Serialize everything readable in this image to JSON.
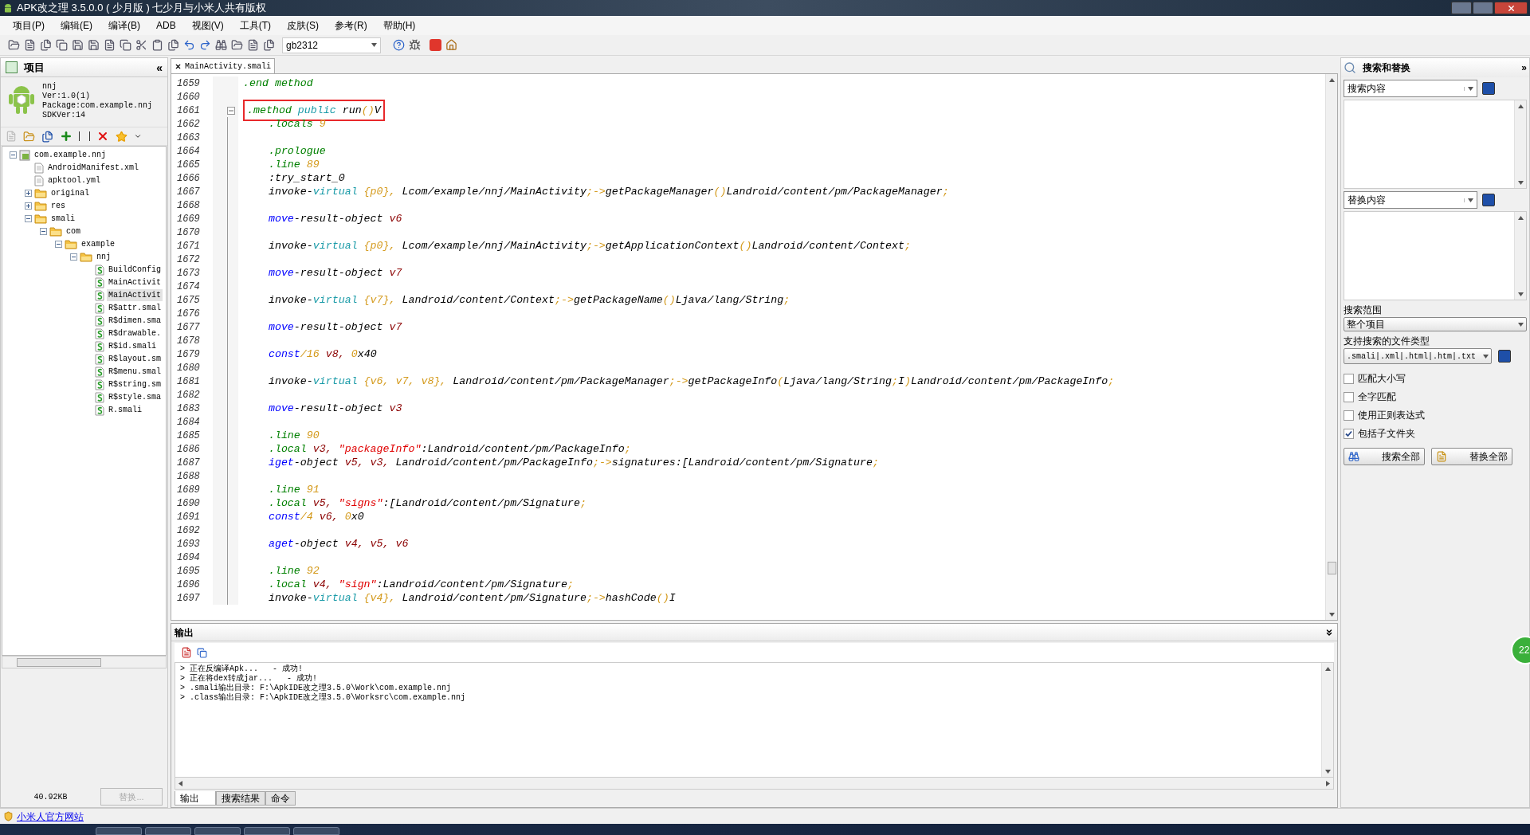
{
  "window": {
    "title": "APK改之理 3.5.0.0 ( 少月版 ) 七少月与小米人共有版权"
  },
  "menu": [
    "项目(P)",
    "编辑(E)",
    "编译(B)",
    "ADB",
    "视图(V)",
    "工具(T)",
    "皮肤(S)",
    "参考(R)",
    "帮助(H)"
  ],
  "toolbar": {
    "encoding": "gb2312"
  },
  "project_panel": {
    "title": "项目",
    "collapse": "«",
    "app": {
      "name": "nnj",
      "version": "Ver:1.0(1)",
      "package": "Package:com.example.nnj",
      "sdk": "SDKVer:14"
    },
    "tree": [
      {
        "label": "com.example.nnj",
        "kind": "project",
        "expanded": true,
        "selected": false,
        "children": [
          {
            "label": "AndroidManifest.xml",
            "kind": "file",
            "selected": false
          },
          {
            "label": "apktool.yml",
            "kind": "file",
            "selected": false
          },
          {
            "label": "original",
            "kind": "folder",
            "expanded": false,
            "selected": false
          },
          {
            "label": "res",
            "kind": "folder",
            "expanded": false,
            "selected": false
          },
          {
            "label": "smali",
            "kind": "folder",
            "expanded": true,
            "selected": false,
            "children": [
              {
                "label": "com",
                "kind": "folder",
                "expanded": true,
                "selected": false,
                "children": [
                  {
                    "label": "example",
                    "kind": "folder",
                    "expanded": true,
                    "selected": false,
                    "children": [
                      {
                        "label": "nnj",
                        "kind": "folder",
                        "expanded": true,
                        "selected": false,
                        "children": [
                          {
                            "label": "BuildConfig",
                            "kind": "smali",
                            "selected": false
                          },
                          {
                            "label": "MainActivit",
                            "kind": "smali",
                            "selected": false
                          },
                          {
                            "label": "MainActivit",
                            "kind": "smali",
                            "selected": true
                          },
                          {
                            "label": "R$attr.smal",
                            "kind": "smali",
                            "selected": false
                          },
                          {
                            "label": "R$dimen.sma",
                            "kind": "smali",
                            "selected": false
                          },
                          {
                            "label": "R$drawable.",
                            "kind": "smali",
                            "selected": false
                          },
                          {
                            "label": "R$id.smali",
                            "kind": "smali",
                            "selected": false
                          },
                          {
                            "label": "R$layout.sm",
                            "kind": "smali",
                            "selected": false
                          },
                          {
                            "label": "R$menu.smal",
                            "kind": "smali",
                            "selected": false
                          },
                          {
                            "label": "R$string.sm",
                            "kind": "smali",
                            "selected": false
                          },
                          {
                            "label": "R$style.sma",
                            "kind": "smali",
                            "selected": false
                          },
                          {
                            "label": "R.smali",
                            "kind": "smali",
                            "selected": false
                          }
                        ]
                      }
                    ]
                  }
                ]
              }
            ]
          }
        ]
      }
    ],
    "size": "40.92KB",
    "replace_button": {
      "label": "替换...",
      "disabled": true
    }
  },
  "editor": {
    "tabs": [
      {
        "label": "MainActivity.smali",
        "selected": true
      }
    ],
    "lines": [
      {
        "number": "1659",
        "fold": false,
        "boxed": false,
        "tokens": [
          {
            "kind": "directive",
            "text": ".end method"
          }
        ]
      },
      {
        "number": "1660",
        "fold": false
      },
      {
        "number": "1661",
        "fold": true,
        "boxed": true,
        "tokens": [
          {
            "kind": "directive",
            "text": ".method "
          },
          {
            "kind": "keyword",
            "text": "public"
          },
          {
            "kind": "plain",
            "text": " run"
          },
          {
            "kind": "punct",
            "text": "()"
          },
          {
            "kind": "plain",
            "text": "V"
          }
        ]
      },
      {
        "number": "1662",
        "fold": false,
        "boxed": false,
        "tokens": [
          {
            "kind": "directive",
            "text": "    .locals "
          },
          {
            "kind": "punct",
            "text": "9"
          }
        ]
      },
      {
        "number": "1663",
        "fold": false
      },
      {
        "number": "1664",
        "fold": false,
        "boxed": false,
        "tokens": [
          {
            "kind": "directive",
            "text": "    .prologue"
          }
        ]
      },
      {
        "number": "1665",
        "fold": false,
        "boxed": false,
        "tokens": [
          {
            "kind": "directive",
            "text": "    .line "
          },
          {
            "kind": "punct",
            "text": "89"
          }
        ]
      },
      {
        "number": "1666",
        "fold": false,
        "boxed": false,
        "tokens": [
          {
            "kind": "plain",
            "text": "    :try_start_0"
          }
        ]
      },
      {
        "number": "1667",
        "fold": false,
        "boxed": false,
        "tokens": [
          {
            "kind": "plain",
            "text": "    invoke-"
          },
          {
            "kind": "keyword",
            "text": "virtual"
          },
          {
            "kind": "punct",
            "text": " {p0}, "
          },
          {
            "kind": "plain",
            "text": "Lcom/example/nnj/MainActivity"
          },
          {
            "kind": "punct",
            "text": ";->"
          },
          {
            "kind": "plain",
            "text": "getPackageManager"
          },
          {
            "kind": "punct",
            "text": "()"
          },
          {
            "kind": "plain",
            "text": "Landroid/content/pm/PackageManager"
          },
          {
            "kind": "punct",
            "text": ";"
          }
        ]
      },
      {
        "number": "1668",
        "fold": false
      },
      {
        "number": "1669",
        "fold": false,
        "boxed": false,
        "tokens": [
          {
            "kind": "op",
            "text": "    move"
          },
          {
            "kind": "plain",
            "text": "-result-object "
          },
          {
            "kind": "register",
            "text": "v6"
          }
        ]
      },
      {
        "number": "1670",
        "fold": false
      },
      {
        "number": "1671",
        "fold": false,
        "boxed": false,
        "tokens": [
          {
            "kind": "plain",
            "text": "    invoke-"
          },
          {
            "kind": "keyword",
            "text": "virtual"
          },
          {
            "kind": "punct",
            "text": " {p0}, "
          },
          {
            "kind": "plain",
            "text": "Lcom/example/nnj/MainActivity"
          },
          {
            "kind": "punct",
            "text": ";->"
          },
          {
            "kind": "plain",
            "text": "getApplicationContext"
          },
          {
            "kind": "punct",
            "text": "()"
          },
          {
            "kind": "plain",
            "text": "Landroid/content/Context"
          },
          {
            "kind": "punct",
            "text": ";"
          }
        ]
      },
      {
        "number": "1672",
        "fold": false
      },
      {
        "number": "1673",
        "fold": false,
        "boxed": false,
        "tokens": [
          {
            "kind": "op",
            "text": "    move"
          },
          {
            "kind": "plain",
            "text": "-result-object "
          },
          {
            "kind": "register",
            "text": "v7"
          }
        ]
      },
      {
        "number": "1674",
        "fold": false
      },
      {
        "number": "1675",
        "fold": false,
        "boxed": false,
        "tokens": [
          {
            "kind": "plain",
            "text": "    invoke-"
          },
          {
            "kind": "keyword",
            "text": "virtual"
          },
          {
            "kind": "punct",
            "text": " {v7}, "
          },
          {
            "kind": "plain",
            "text": "Landroid/content/Context"
          },
          {
            "kind": "punct",
            "text": ";->"
          },
          {
            "kind": "plain",
            "text": "getPackageName"
          },
          {
            "kind": "punct",
            "text": "()"
          },
          {
            "kind": "plain",
            "text": "Ljava/lang/String"
          },
          {
            "kind": "punct",
            "text": ";"
          }
        ]
      },
      {
        "number": "1676",
        "fold": false
      },
      {
        "number": "1677",
        "fold": false,
        "boxed": false,
        "tokens": [
          {
            "kind": "op",
            "text": "    move"
          },
          {
            "kind": "plain",
            "text": "-result-object "
          },
          {
            "kind": "register",
            "text": "v7"
          }
        ]
      },
      {
        "number": "1678",
        "fold": false
      },
      {
        "number": "1679",
        "fold": false,
        "boxed": false,
        "tokens": [
          {
            "kind": "op",
            "text": "    const"
          },
          {
            "kind": "punct",
            "text": "/16"
          },
          {
            "kind": "register",
            "text": " v8, "
          },
          {
            "kind": "punct",
            "text": "0"
          },
          {
            "kind": "plain",
            "text": "x40"
          }
        ]
      },
      {
        "number": "1680",
        "fold": false
      },
      {
        "number": "1681",
        "fold": false,
        "boxed": false,
        "tokens": [
          {
            "kind": "plain",
            "text": "    invoke-"
          },
          {
            "kind": "keyword",
            "text": "virtual"
          },
          {
            "kind": "punct",
            "text": " {v6, v7, v8}, "
          },
          {
            "kind": "plain",
            "text": "Landroid/content/pm/PackageManager"
          },
          {
            "kind": "punct",
            "text": ";->"
          },
          {
            "kind": "plain",
            "text": "getPackageInfo"
          },
          {
            "kind": "punct",
            "text": "("
          },
          {
            "kind": "plain",
            "text": "Ljava/lang/String"
          },
          {
            "kind": "punct",
            "text": ";"
          },
          {
            "kind": "plain",
            "text": "I"
          },
          {
            "kind": "punct",
            "text": ")"
          },
          {
            "kind": "plain",
            "text": "Landroid/content/pm/PackageInfo"
          },
          {
            "kind": "punct",
            "text": ";"
          }
        ]
      },
      {
        "number": "1682",
        "fold": false
      },
      {
        "number": "1683",
        "fold": false,
        "boxed": false,
        "tokens": [
          {
            "kind": "op",
            "text": "    move"
          },
          {
            "kind": "plain",
            "text": "-result-object "
          },
          {
            "kind": "register",
            "text": "v3"
          }
        ]
      },
      {
        "number": "1684",
        "fold": false
      },
      {
        "number": "1685",
        "fold": false,
        "boxed": false,
        "tokens": [
          {
            "kind": "directive",
            "text": "    .line "
          },
          {
            "kind": "punct",
            "text": "90"
          }
        ]
      },
      {
        "number": "1686",
        "fold": false,
        "boxed": false,
        "tokens": [
          {
            "kind": "directive",
            "text": "    .local "
          },
          {
            "kind": "register",
            "text": "v3, "
          },
          {
            "kind": "string",
            "text": "\"packageInfo\""
          },
          {
            "kind": "plain",
            "text": ":Landroid/content/pm/PackageInfo"
          },
          {
            "kind": "punct",
            "text": ";"
          }
        ]
      },
      {
        "number": "1687",
        "fold": false,
        "boxed": false,
        "tokens": [
          {
            "kind": "op",
            "text": "    iget"
          },
          {
            "kind": "plain",
            "text": "-object "
          },
          {
            "kind": "register",
            "text": "v5, v3, "
          },
          {
            "kind": "plain",
            "text": "Landroid/content/pm/PackageInfo"
          },
          {
            "kind": "punct",
            "text": ";->"
          },
          {
            "kind": "plain",
            "text": "signatures:[Landroid/content/pm/Signature"
          },
          {
            "kind": "punct",
            "text": ";"
          }
        ]
      },
      {
        "number": "1688",
        "fold": false
      },
      {
        "number": "1689",
        "fold": false,
        "boxed": false,
        "tokens": [
          {
            "kind": "directive",
            "text": "    .line "
          },
          {
            "kind": "punct",
            "text": "91"
          }
        ]
      },
      {
        "number": "1690",
        "fold": false,
        "boxed": false,
        "tokens": [
          {
            "kind": "directive",
            "text": "    .local "
          },
          {
            "kind": "register",
            "text": "v5, "
          },
          {
            "kind": "string",
            "text": "\"signs\""
          },
          {
            "kind": "plain",
            "text": ":[Landroid/content/pm/Signature"
          },
          {
            "kind": "punct",
            "text": ";"
          }
        ]
      },
      {
        "number": "1691",
        "fold": false,
        "boxed": false,
        "tokens": [
          {
            "kind": "op",
            "text": "    const"
          },
          {
            "kind": "punct",
            "text": "/4"
          },
          {
            "kind": "register",
            "text": " v6, "
          },
          {
            "kind": "punct",
            "text": "0"
          },
          {
            "kind": "plain",
            "text": "x0"
          }
        ]
      },
      {
        "number": "1692",
        "fold": false
      },
      {
        "number": "1693",
        "fold": false,
        "boxed": false,
        "tokens": [
          {
            "kind": "op",
            "text": "    aget"
          },
          {
            "kind": "plain",
            "text": "-object "
          },
          {
            "kind": "register",
            "text": "v4, v5, v6"
          }
        ]
      },
      {
        "number": "1694",
        "fold": false
      },
      {
        "number": "1695",
        "fold": false,
        "boxed": false,
        "tokens": [
          {
            "kind": "directive",
            "text": "    .line "
          },
          {
            "kind": "punct",
            "text": "92"
          }
        ]
      },
      {
        "number": "1696",
        "fold": false,
        "boxed": false,
        "tokens": [
          {
            "kind": "directive",
            "text": "    .local "
          },
          {
            "kind": "register",
            "text": "v4, "
          },
          {
            "kind": "string",
            "text": "\"sign\""
          },
          {
            "kind": "plain",
            "text": ":Landroid/content/pm/Signature"
          },
          {
            "kind": "punct",
            "text": ";"
          }
        ]
      },
      {
        "number": "1697",
        "fold": false,
        "boxed": false,
        "tokens": [
          {
            "kind": "plain",
            "text": "    invoke-"
          },
          {
            "kind": "keyword",
            "text": "virtual"
          },
          {
            "kind": "punct",
            "text": " {v4}, "
          },
          {
            "kind": "plain",
            "text": "Landroid/content/pm/Signature"
          },
          {
            "kind": "punct",
            "text": ";->"
          },
          {
            "kind": "plain",
            "text": "hashCode"
          },
          {
            "kind": "punct",
            "text": "()"
          },
          {
            "kind": "plain",
            "text": "I"
          }
        ]
      }
    ]
  },
  "output": {
    "title": "输出",
    "lines": [
      "> 正在反编译Apk...   - 成功!",
      "> 正在将dex转成jar...   - 成功!",
      "> .smali输出目录: F:\\ApkIDE改之理3.5.0\\Work\\com.example.nnj",
      "> .class输出目录: F:\\ApkIDE改之理3.5.0\\Worksrc\\com.example.nnj"
    ],
    "tabs": [
      {
        "label": "输出",
        "selected": true
      },
      {
        "label": "搜索结果",
        "selected": false
      },
      {
        "label": "命令",
        "selected": false
      }
    ]
  },
  "search_panel": {
    "title": "搜索和替换",
    "collapse": "»",
    "search_combo": "搜索内容",
    "replace_combo": "替换内容",
    "scope_label": "搜索范围",
    "scope": "整个项目",
    "types_label": "支持搜索的文件类型",
    "types": ".smali|.xml|.html|.htm|.txt",
    "options": [
      {
        "label": "匹配大小写",
        "checked": false
      },
      {
        "label": "全字匹配",
        "checked": false
      },
      {
        "label": "使用正则表达式",
        "checked": false
      },
      {
        "label": "包括子文件夹",
        "checked": true
      }
    ],
    "buttons": [
      {
        "label": "搜索全部",
        "kind": "search"
      },
      {
        "label": "替换全部",
        "kind": "replace"
      }
    ]
  },
  "badge": "22",
  "status_bar": {
    "link": "小米人官方网站"
  }
}
